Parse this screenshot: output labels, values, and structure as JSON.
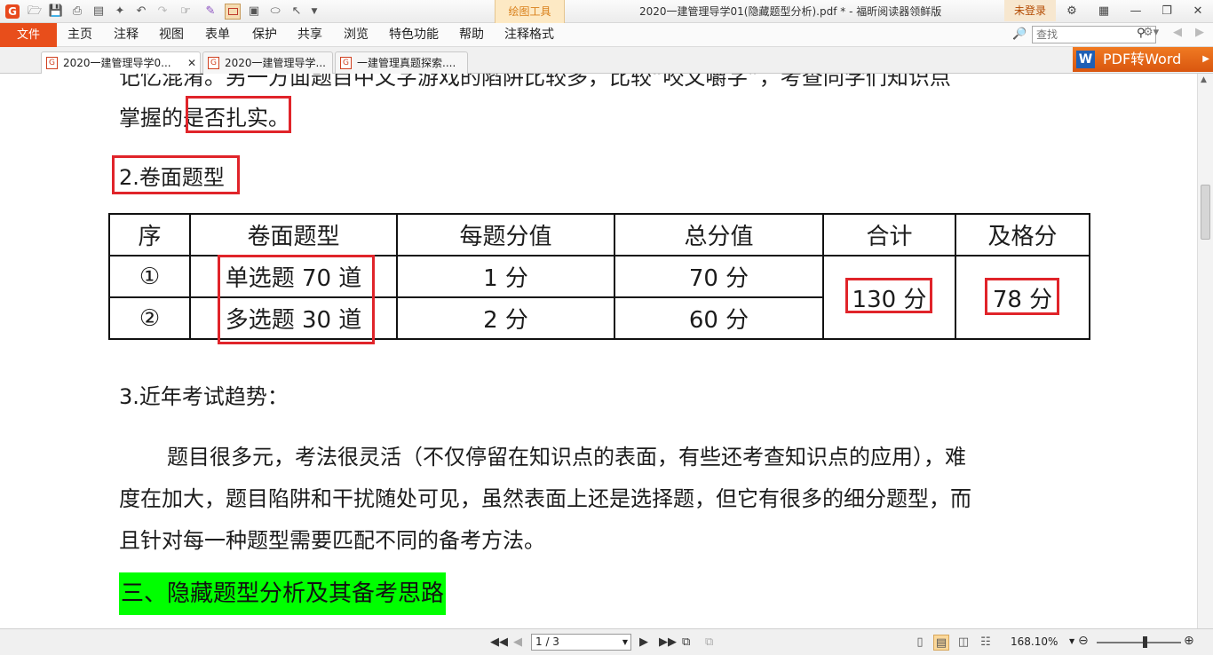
{
  "titlebar": {
    "context_tab": "绘图工具",
    "window_title": "2020一建管理导学01(隐藏题型分析).pdf * - 福昕阅读器领鲜版",
    "login": "未登录"
  },
  "menu": {
    "file": "文件",
    "items": [
      "主页",
      "注释",
      "视图",
      "表单",
      "保护",
      "共享",
      "浏览",
      "特色功能",
      "帮助",
      "注释格式"
    ]
  },
  "search": {
    "placeholder": "查找"
  },
  "tabs": [
    {
      "label": "2020一建管理导学0..."
    },
    {
      "label": "2020一建管理导学..."
    },
    {
      "label": "一建管理真题探索...."
    }
  ],
  "pdf2word": {
    "label": "PDF转Word"
  },
  "document": {
    "partial_top": "记忆混淆。另一方面题目中文字游戏的陷阱比较多，比较“咬文嚼字”，考查同学们知识点",
    "line2_prefix": "掌握的",
    "line2_boxed": "是否扎实",
    "line2_suffix": "。",
    "heading2": "2.卷面题型",
    "table": {
      "headers": [
        "序",
        "卷面题型",
        "每题分值",
        "总分值",
        "合计",
        "及格分"
      ],
      "rows": [
        {
          "index": "①",
          "type": "单选题 70 道",
          "per": "1 分",
          "total": "70 分"
        },
        {
          "index": "②",
          "type": "多选题 30 道",
          "per": "2 分",
          "total": "60 分"
        }
      ],
      "sum": "130 分",
      "pass": "78 分"
    },
    "heading_trend": "3.近年考试趋势：",
    "para_lines": [
      "题目很多元，考法很灵活（不仅停留在知识点的表面，有些还考查知识点的应用），难",
      "度在加大，题目陷阱和干扰随处可见，虽然表面上还是选择题，但它有很多的细分题型，而",
      "且针对每一种题型需要匹配不同的备考方法。"
    ],
    "heading3": "三、隐藏题型分析及其备考思路"
  },
  "status": {
    "page": "1 / 3",
    "zoom": "168.10%"
  },
  "colors": {
    "accent": "#e84e1b",
    "highlight": "#00ff00",
    "annotation": "#e0242a"
  }
}
